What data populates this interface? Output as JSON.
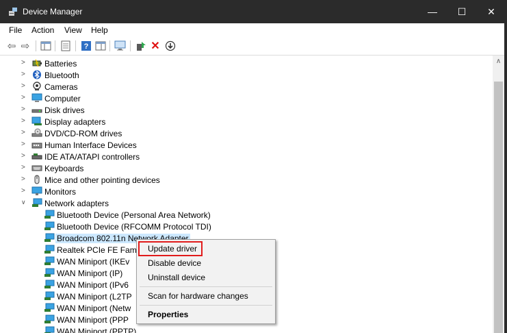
{
  "window": {
    "title": "Device Manager",
    "controls": {
      "minimize": "—",
      "maximize": "☐",
      "close": "✕"
    }
  },
  "menu": [
    "File",
    "Action",
    "View",
    "Help"
  ],
  "toolbar": {
    "back": "⇦",
    "forward": "⇨",
    "delete": "✕",
    "download": "⬇"
  },
  "tree": {
    "categories": [
      {
        "label": "Batteries",
        "icon": "battery-icon"
      },
      {
        "label": "Bluetooth",
        "icon": "bluetooth-icon"
      },
      {
        "label": "Cameras",
        "icon": "camera-icon"
      },
      {
        "label": "Computer",
        "icon": "computer-icon"
      },
      {
        "label": "Disk drives",
        "icon": "disk-drive-icon"
      },
      {
        "label": "Display adapters",
        "icon": "display-adapter-icon"
      },
      {
        "label": "DVD/CD-ROM drives",
        "icon": "dvd-drive-icon"
      },
      {
        "label": "Human Interface Devices",
        "icon": "hid-icon"
      },
      {
        "label": "IDE ATA/ATAPI controllers",
        "icon": "ide-controller-icon"
      },
      {
        "label": "Keyboards",
        "icon": "keyboard-icon"
      },
      {
        "label": "Mice and other pointing devices",
        "icon": "mouse-icon"
      },
      {
        "label": "Monitors",
        "icon": "monitor-icon"
      },
      {
        "label": "Network adapters",
        "icon": "network-adapter-icon",
        "expanded": true
      }
    ],
    "network_children": [
      "Bluetooth Device (Personal Area Network)",
      "Bluetooth Device (RFCOMM Protocol TDI)",
      "Broadcom 802.11n Network Adapter",
      "Realtek PCIe FE Fam",
      "WAN Miniport (IKEv",
      "WAN Miniport (IP)",
      "WAN Miniport (IPv6",
      "WAN Miniport (L2TP",
      "WAN Miniport (Netw",
      "WAN Miniport (PPP",
      "WAN Miniport (PPTP)"
    ],
    "selected": "Broadcom 802.11n Network Adapter"
  },
  "context_menu": {
    "items": [
      "Update driver",
      "Disable device",
      "Uninstall device",
      "Scan for hardware changes",
      "Properties"
    ],
    "highlighted": "Update driver"
  },
  "colors": {
    "titlebar": "#2b2b2b",
    "selection": "#cce8ff",
    "highlight_box": "#e11b1b",
    "menu_bg": "#f2f2f2"
  }
}
